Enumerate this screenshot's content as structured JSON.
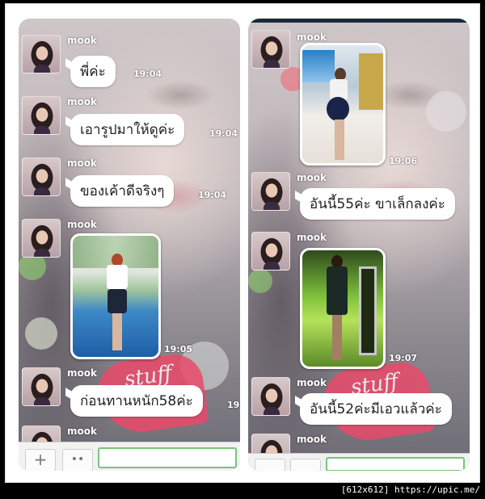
{
  "left_panel": {
    "messages": [
      {
        "sender": "mook",
        "text": "พี่ค่ะ",
        "time": "19:04"
      },
      {
        "sender": "mook",
        "text": "เอารูปมาให้ดูค่ะ",
        "time": "19:04"
      },
      {
        "sender": "mook",
        "text": "ของเค้าดีจริงๆ",
        "time": "19:04"
      },
      {
        "sender": "mook",
        "time": "19:05"
      },
      {
        "sender": "mook",
        "text": "ก่อนทานหนัก58ค่ะ",
        "time": "19"
      },
      {
        "sender": "mook"
      }
    ],
    "input": {
      "plus_label": "+",
      "sticker_label": "••"
    },
    "watermark": "stuff shop"
  },
  "right_panel": {
    "messages": [
      {
        "sender": "mook",
        "time": "19:06"
      },
      {
        "sender": "mook",
        "text": "อันนี้55ค่ะ ขาเล็กลงค่ะ"
      },
      {
        "sender": "mook",
        "time": "19:07"
      },
      {
        "sender": "mook",
        "text": "อันนี้52ค่ะมีเอวแล้วค่ะ"
      },
      {
        "sender": "mook"
      }
    ],
    "watermark": "stuff shop"
  },
  "footer": {
    "text": "[612x612] https://upic.me/"
  },
  "colors": {
    "bubble": "#ffffff",
    "input_border": "#7ac37a",
    "frame_bg": "#000000"
  }
}
